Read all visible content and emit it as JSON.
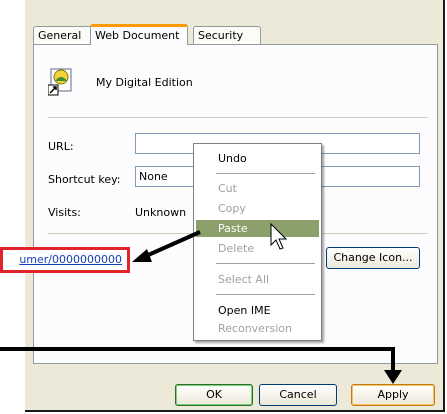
{
  "tabs": [
    "General",
    "Web Document",
    "Security"
  ],
  "document_name": "My Digital Edition",
  "fields": {
    "url_label": "URL:",
    "url_value": "",
    "shortcut_label": "Shortcut key:",
    "shortcut_value": "None",
    "visits_label": "Visits:",
    "visits_value": "Unknown"
  },
  "change_icon_label": "Change Icon...",
  "buttons": {
    "ok": "OK",
    "cancel": "Cancel",
    "apply": "Apply"
  },
  "context_menu": {
    "undo": "Undo",
    "cut": "Cut",
    "copy": "Copy",
    "paste": "Paste",
    "delete": "Delete",
    "select_all": "Select All",
    "open_ime": "Open IME",
    "reconversion": "Reconversion"
  },
  "callout_text": "umer/0000000000",
  "icons": {
    "document": "internet-shortcut-icon",
    "cursor": "mouse-pointer-icon"
  },
  "colors": {
    "callout_border": "#e3232a",
    "arrow": "#000000",
    "highlight": "#8ba06a",
    "tab_accent": "#ff9a00"
  }
}
